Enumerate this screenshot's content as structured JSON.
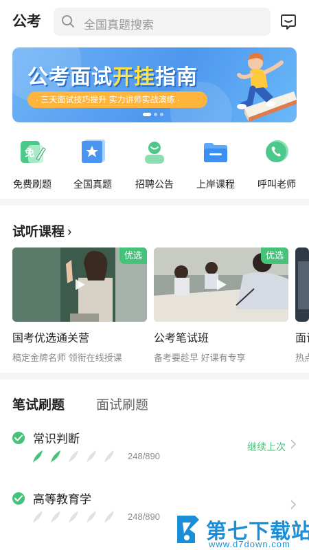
{
  "header": {
    "title": "公考",
    "search_placeholder": "全国真题搜索"
  },
  "banner": {
    "title_part1": "公考面试",
    "title_highlight": "开挂",
    "title_part2": "指南",
    "subtitle": "· 三天面试技巧提升 实力讲师实战演练 ·",
    "dots": 3,
    "active_dot": 0
  },
  "quick_menu": [
    {
      "label": "免费刷题",
      "icon": "free-practice-icon"
    },
    {
      "label": "全国真题",
      "icon": "national-exam-icon"
    },
    {
      "label": "招聘公告",
      "icon": "recruitment-icon"
    },
    {
      "label": "上岸课程",
      "icon": "course-folder-icon"
    },
    {
      "label": "呼叫老师",
      "icon": "phone-call-icon"
    }
  ],
  "trial": {
    "title": "试听课程",
    "courses": [
      {
        "title": "国考优选通关营",
        "desc": "稿定金牌名师 领衔在线授课",
        "badge": "优选"
      },
      {
        "title": "公考笔试班",
        "desc": "备考要趁早 好课有专享",
        "badge": "优选"
      },
      {
        "title": "面试",
        "desc": "热点",
        "badge": ""
      }
    ]
  },
  "tabs": {
    "active": "笔试刷题",
    "inactive": "面试刷题"
  },
  "practice": [
    {
      "name": "常识判断",
      "progress": "248/890",
      "feathers_filled": 2,
      "action": "继续上次"
    },
    {
      "name": "高等教育学",
      "progress": "248/890",
      "feathers_filled": 0,
      "action": ""
    }
  ],
  "watermark": {
    "name": "第七下载站",
    "url": "www.d7down.com"
  },
  "colors": {
    "accent_green": "#46c27a",
    "banner_blue": "#4d97ee",
    "banner_yellow": "#ffe14a"
  }
}
